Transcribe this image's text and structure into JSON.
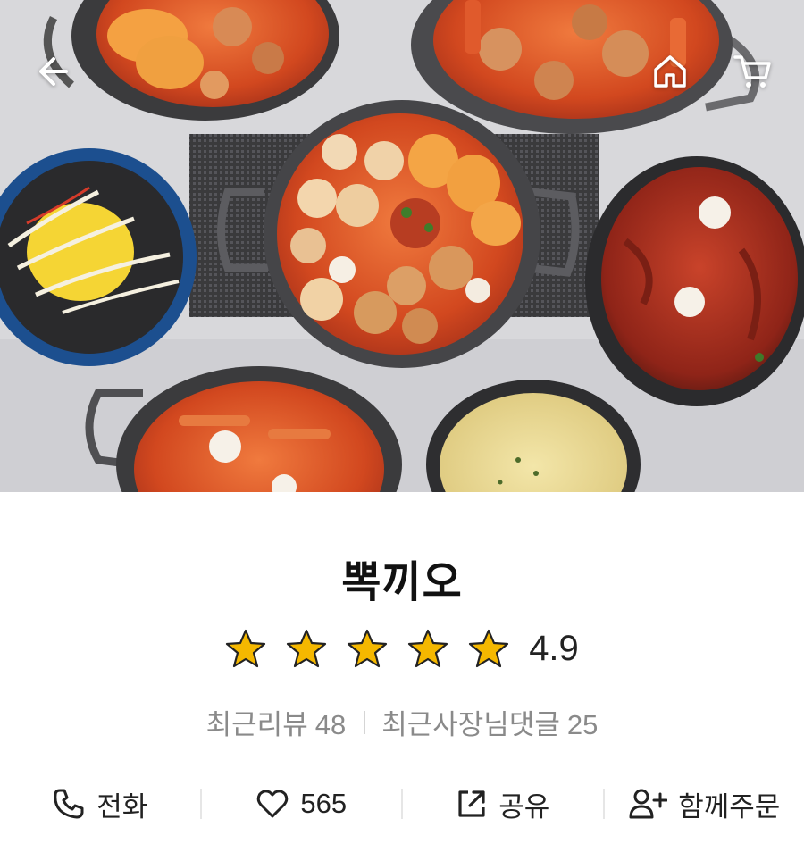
{
  "header": {
    "back_icon": "arrow-left-icon",
    "home_icon": "home-icon",
    "cart_icon": "cart-icon"
  },
  "hero": {
    "image": "food-photo (tteokbokki pots, rice bowl, stir-fried dishes)"
  },
  "store": {
    "name": "뽁끼오",
    "rating": "4.9",
    "rating_stars": 5,
    "star_color": "#F5B800",
    "recent_reviews_label": "최근리뷰",
    "recent_reviews_count": "48",
    "owner_replies_label": "최근사장님댓글",
    "owner_replies_count": "25"
  },
  "actions": {
    "call_label": "전화",
    "call_icon": "phone-icon",
    "like_count": "565",
    "like_icon": "heart-icon",
    "share_label": "공유",
    "share_icon": "share-icon",
    "group_order_label": "함께주문",
    "group_order_icon": "add-person-icon"
  }
}
